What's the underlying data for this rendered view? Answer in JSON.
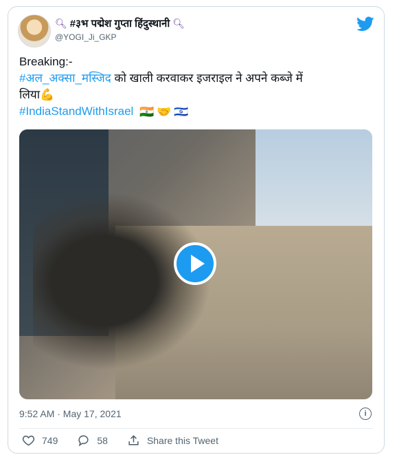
{
  "tweet": {
    "author_name": "#३भ पद्मेश गुप्ता हिंदुस्थानी",
    "handle": "@YOGI_Ji_GKP",
    "lines": {
      "l1": "Breaking:-",
      "l2_tag": "#अल_अक्सा_मस्जिद",
      "l2_text": " को खाली करवाकर इजराइल ने अपने कब्जे में",
      "l3_text": "लिया💪",
      "l4_tag": "#IndiaStandWithIsrael"
    },
    "emojis": [
      "🇮🇳",
      "🤝",
      "🇮🇱"
    ],
    "timestamp": "9:52 AM · May 17, 2021",
    "likes": "749",
    "replies": "58",
    "share_label": "Share this Tweet",
    "accent_color": "#1d9bf0",
    "icons": [
      "twitter-bird-icon",
      "magnifier-icon",
      "play-icon",
      "info-icon",
      "heart-icon",
      "reply-icon",
      "share-icon"
    ]
  }
}
